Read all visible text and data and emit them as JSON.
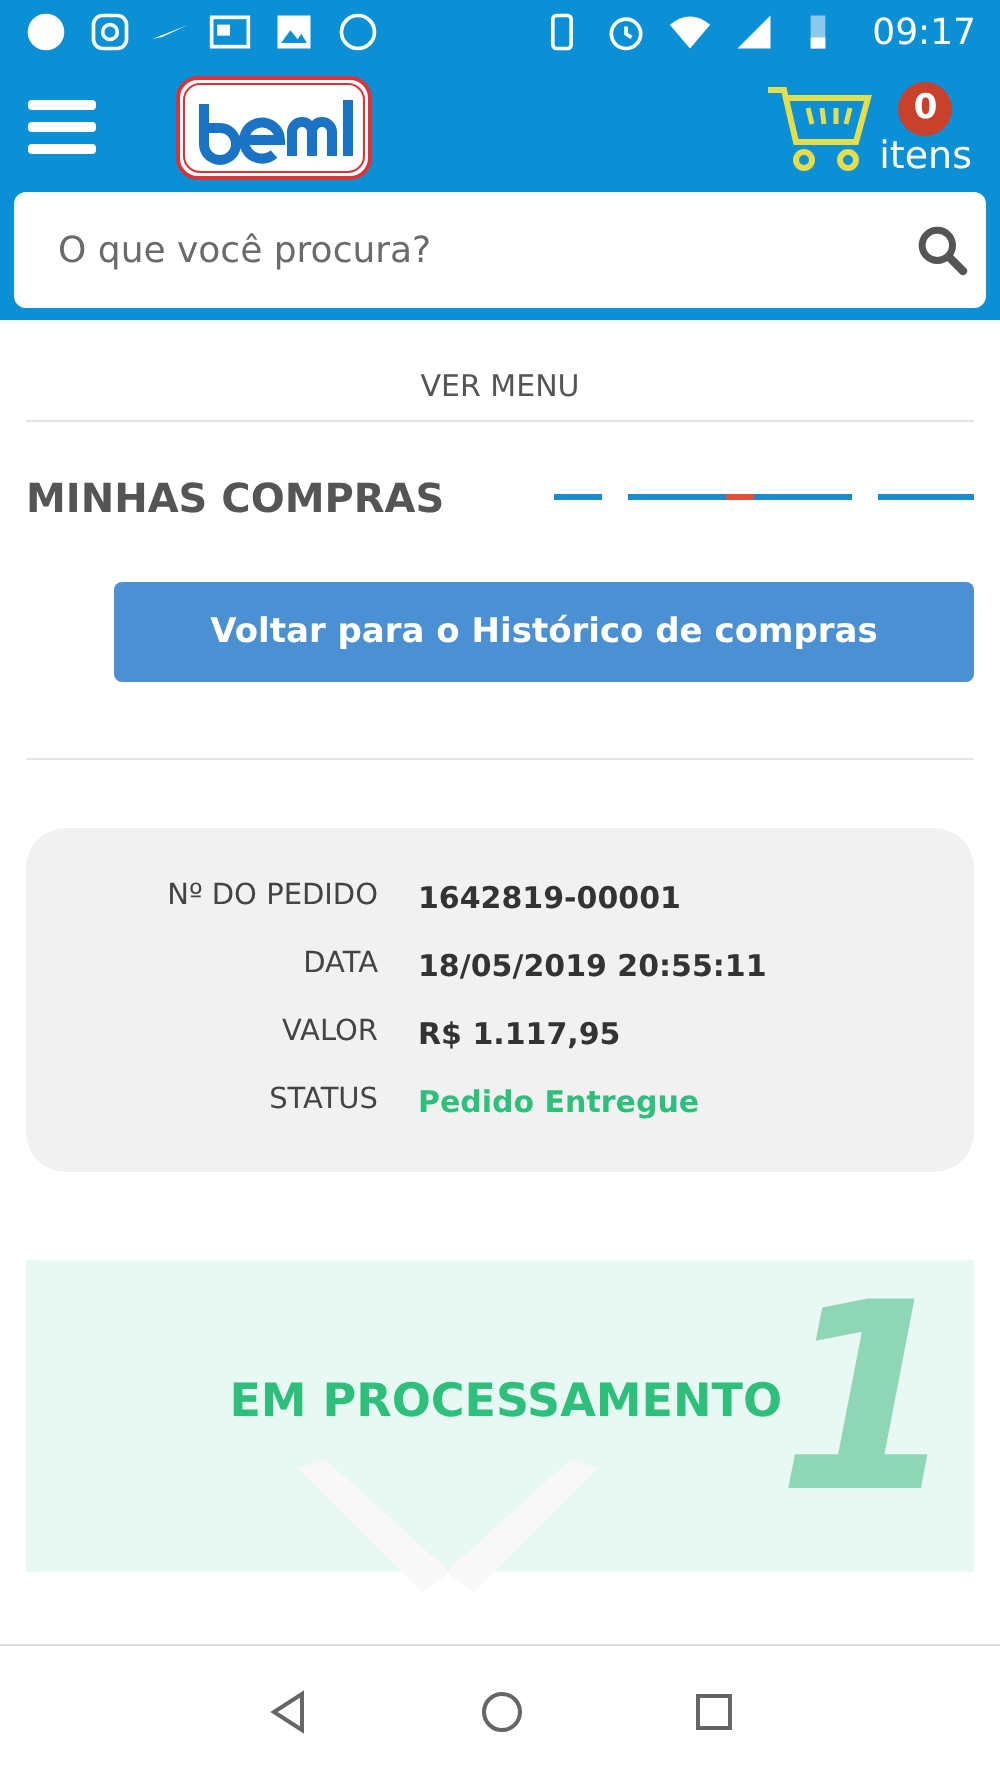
{
  "status_bar": {
    "time": "09:17"
  },
  "header": {
    "cart": {
      "count": "0",
      "label": "itens"
    }
  },
  "search": {
    "placeholder": "O que você procura?"
  },
  "menu_link": "VER MENU",
  "page_title": "MINHAS COMPRAS",
  "back_button": "Voltar para o Histórico de compras",
  "order": [
    {
      "label": "Nº DO PEDIDO",
      "value": "1642819-00001",
      "kind": "plain"
    },
    {
      "label": "DATA",
      "value": "18/05/2019 20:55:11",
      "kind": "plain"
    },
    {
      "label": "VALOR",
      "value": "R$ 1.117,95",
      "kind": "plain"
    },
    {
      "label": "STATUS",
      "value": "Pedido Entregue",
      "kind": "status"
    }
  ],
  "step": {
    "number": "1",
    "title": "EM PROCESSAMENTO"
  }
}
